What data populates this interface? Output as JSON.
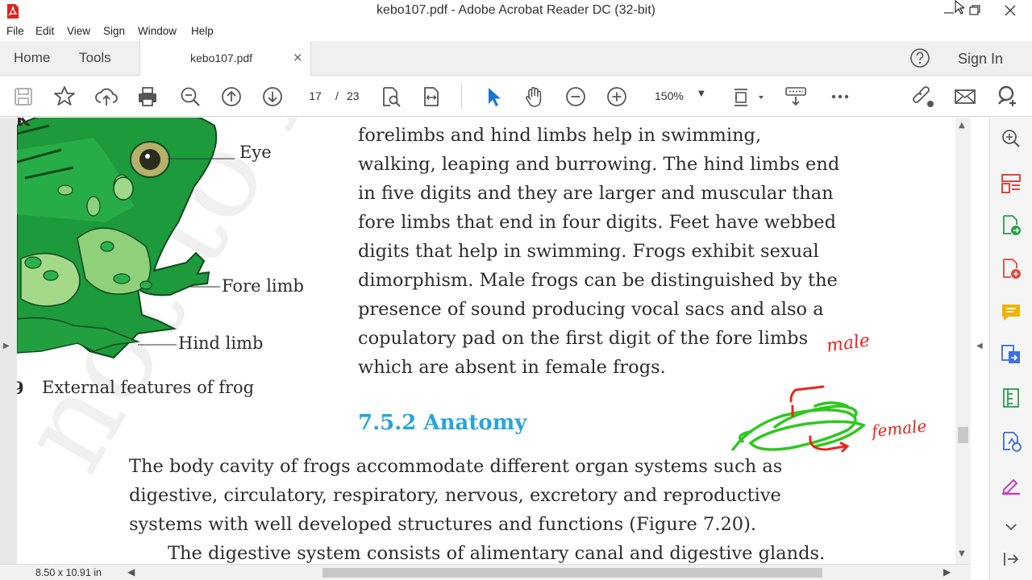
{
  "window": {
    "title": "kebo107.pdf - Adobe Acrobat Reader DC (32-bit)"
  },
  "menu": [
    "File",
    "Edit",
    "View",
    "Sign",
    "Window",
    "Help"
  ],
  "tabs": {
    "home": "Home",
    "tools": "Tools",
    "document": "kebo107.pdf",
    "close": "×",
    "sign_in": "Sign In"
  },
  "toolbar": {
    "current_page": "17",
    "separator": "/",
    "total_pages": "23",
    "zoom": "150%"
  },
  "document": {
    "figure_labels": {
      "eye": "Eye",
      "fore_limb": "Fore limb",
      "hind_limb": "Hind limb"
    },
    "figure_number_fragment": "9",
    "caption": "External features of frog",
    "top_fragment": "K",
    "paragraph_lines": [
      "forelimbs  and  hind  limbs  help  in  swimming,",
      "walking, leaping and burrowing. The hind limbs end",
      "in five digits and they are larger and muscular than",
      "fore limbs that end in four digits. Feet have webbed",
      "digits that help in swimming. Frogs exhibit sexual",
      "dimorphism. Male frogs can be distinguished by the",
      "presence of sound producing vocal sacs and also a",
      "copulatory pad on the first digit of the fore limbs",
      "which are absent in female frogs."
    ],
    "section_heading": "7.5.2  Anatomy",
    "anatomy_lines": [
      "The body cavity of frogs accommodate different organ systems such as",
      "digestive, circulatory, respiratory, nervous, excretory and reproductive",
      "systems with well developed structures and functions  (Figure 7.20).",
      "The digestive system consists of alimentary canal and digestive glands."
    ],
    "watermark": "not to be",
    "annotation_male": "male",
    "annotation_female": "female"
  },
  "status": {
    "page_size": "8.50 x 10.91 in"
  },
  "colors": {
    "accent_heading": "#2aa4d8",
    "ink_red": "#e8261e",
    "ink_green": "#2ec81e"
  }
}
